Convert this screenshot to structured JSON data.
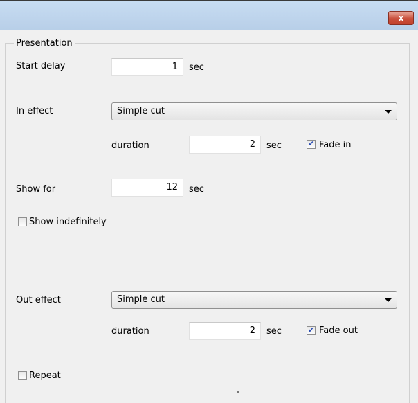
{
  "window": {
    "close_label": "x"
  },
  "group": {
    "title": "Presentation"
  },
  "start_delay": {
    "label": "Start delay",
    "value": "1",
    "unit": "sec"
  },
  "in_effect": {
    "label": "In effect",
    "selected": "Simple cut",
    "duration_label": "duration",
    "duration_value": "2",
    "duration_unit": "sec",
    "fade_label": "Fade in",
    "fade_checked": true
  },
  "show_for": {
    "label": "Show for",
    "value": "12",
    "unit": "sec"
  },
  "show_indefinitely": {
    "label": "Show indefinitely",
    "checked": false
  },
  "out_effect": {
    "label": "Out effect",
    "selected": "Simple cut",
    "duration_label": "duration",
    "duration_value": "2",
    "duration_unit": "sec",
    "fade_label": "Fade out",
    "fade_checked": true
  },
  "repeat": {
    "label": "Repeat",
    "checked": false
  }
}
